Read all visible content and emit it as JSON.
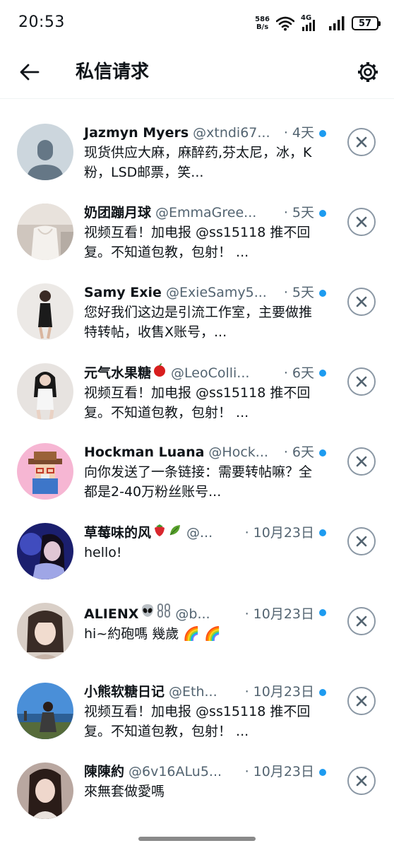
{
  "status_bar": {
    "time": "20:53",
    "net_speed_value": "586",
    "net_speed_unit": "B/s",
    "network": "4G",
    "battery": "57"
  },
  "header": {
    "title": "私信请求",
    "back_icon": "arrow-left-icon",
    "settings_icon": "gear-icon"
  },
  "colors": {
    "unread_dot": "#1d9bf0",
    "secondary_text": "#536471"
  },
  "requests": [
    {
      "name": "Jazmyn Myers",
      "handle": "@xtndi67...",
      "time": "· 4天",
      "preview": "现货供应大麻，麻醉药,芬太尼，冰，K粉，LSD邮票，笑..."
    },
    {
      "name": "奶团蹦月球",
      "handle": "@EmmaGree...",
      "time": "· 5天",
      "preview": "视频互看！加电报 @ss15118 推不回复。不知道包教，包射！ ..."
    },
    {
      "name": "Samy Exie",
      "handle": "@ExieSamy5...",
      "time": "· 5天",
      "preview": "您好我们这边是引流工作室，主要做推特转帖，收售X账号，..."
    },
    {
      "name": "元气水果糖",
      "handle": "@LeoColli...",
      "time": "· 6天",
      "preview": "视频互看！加电报 @ss15118 推不回复。不知道包教，包射！ ..."
    },
    {
      "name": "Hockman Luana",
      "handle": "@Hock...",
      "time": "· 6天",
      "preview": "向你发送了一条链接：需要转帖嘛？全都是2-40万粉丝账号..."
    },
    {
      "name": "草莓味的风",
      "handle": "@...",
      "time": "· 10月23日",
      "preview": "hello!"
    },
    {
      "name": "ALIENX",
      "handle": "@b...",
      "time": "· 10月23日",
      "preview": "hi~約砲嗎 幾歲 🌈 🌈"
    },
    {
      "name": "小熊软糖日记",
      "handle": "@Eth...",
      "time": "· 10月23日",
      "preview": "视频互看！加电报 @ss15118 推不回复。不知道包教，包射！ ..."
    },
    {
      "name": "陳陳約",
      "handle": "@6v16ALu5...",
      "time": "· 10月23日",
      "preview": "來無套做愛嗎"
    }
  ]
}
